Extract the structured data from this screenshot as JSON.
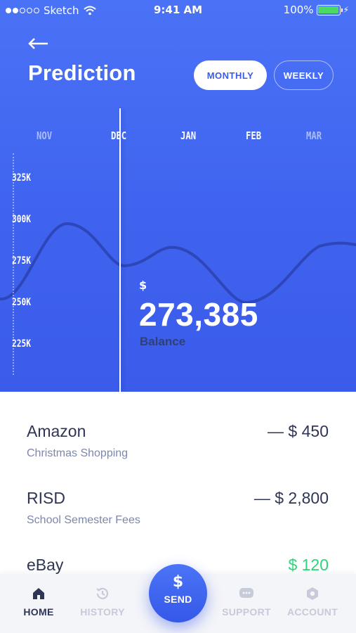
{
  "status_bar": {
    "carrier": "Sketch",
    "time": "9:41 AM",
    "battery_percent": "100%"
  },
  "header": {
    "title": "Prediction",
    "toggle_monthly": "MONTHLY",
    "toggle_weekly": "WEEKLY",
    "selected_toggle": "MONTHLY"
  },
  "chart": {
    "months": [
      "NOV",
      "DEC",
      "JAN",
      "FEB",
      "MAR"
    ],
    "selected_month": "DEC",
    "y_ticks": [
      "325K",
      "300K",
      "275K",
      "250K",
      "225K"
    ],
    "line_color": "#2d46b9"
  },
  "balance": {
    "currency": "$",
    "value": "273,385",
    "label": "Balance"
  },
  "transactions": [
    {
      "name": "Amazon",
      "description": "Christmas Shopping",
      "amount": "— $ 450",
      "type": "debit"
    },
    {
      "name": "RISD",
      "description": "School Semester Fees",
      "amount": "— $ 2,800",
      "type": "debit"
    },
    {
      "name": "eBay",
      "description": "",
      "amount": "$ 120",
      "type": "credit"
    }
  ],
  "tab_bar": {
    "home": "HOME",
    "history": "HISTORY",
    "send": "SEND",
    "send_symbol": "$",
    "support": "SUPPORT",
    "account": "ACCOUNT",
    "active": "HOME"
  },
  "colors": {
    "accent": "#3b5bea",
    "credit": "#2ed47a",
    "text_dark": "#2f3555",
    "text_muted": "#7d87ad"
  }
}
